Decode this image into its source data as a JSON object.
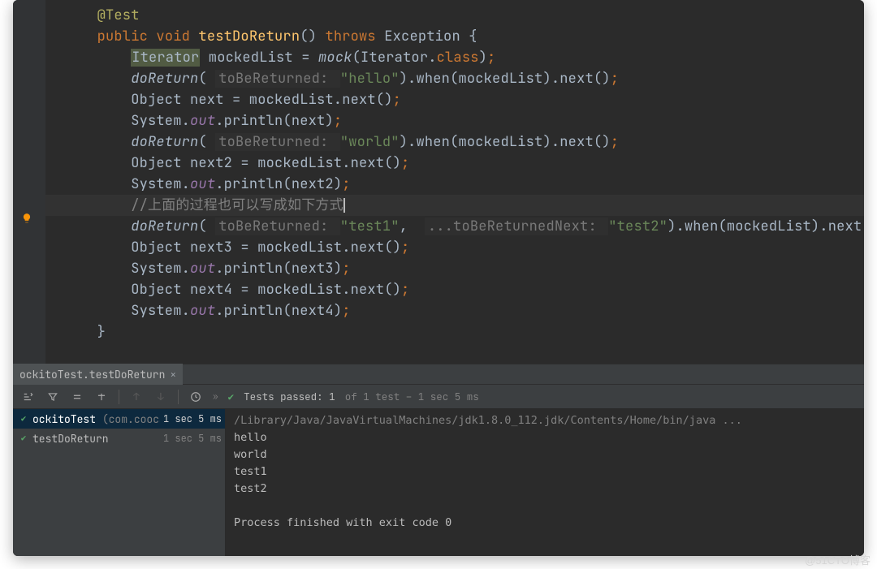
{
  "code": {
    "lines": [
      {
        "indent": 1,
        "segments": [
          {
            "t": "@Test",
            "c": "ann"
          }
        ]
      },
      {
        "indent": 1,
        "segments": [
          {
            "t": "public ",
            "c": "kw"
          },
          {
            "t": "void ",
            "c": "kw"
          },
          {
            "t": "testDoReturn",
            "c": "mname"
          },
          {
            "t": "() ",
            "c": "punct"
          },
          {
            "t": "throws ",
            "c": "kw"
          },
          {
            "t": "Exception ",
            "c": "type"
          },
          {
            "t": "{",
            "c": "punct"
          }
        ]
      },
      {
        "indent": 2,
        "segments": [
          {
            "t": "Iterator",
            "c": "type-hl"
          },
          {
            "t": " mockedList = ",
            "c": "punct"
          },
          {
            "t": "mock",
            "c": "call-it"
          },
          {
            "t": "(Iterator.",
            "c": "punct"
          },
          {
            "t": "class",
            "c": "kw"
          },
          {
            "t": ")",
            "c": "punct"
          },
          {
            "t": ";",
            "c": "sc"
          }
        ]
      },
      {
        "indent": 2,
        "segments": [
          {
            "t": "doReturn",
            "c": "call-it"
          },
          {
            "t": "( ",
            "c": "punct"
          },
          {
            "t": "toBeReturned: ",
            "c": "hint"
          },
          {
            "t": "\"hello\"",
            "c": "str"
          },
          {
            "t": ").",
            "c": "punct"
          },
          {
            "t": "when",
            "c": "punct"
          },
          {
            "t": "(mockedList).",
            "c": "punct"
          },
          {
            "t": "next",
            "c": "punct"
          },
          {
            "t": "()",
            "c": "punct"
          },
          {
            "t": ";",
            "c": "sc"
          }
        ]
      },
      {
        "indent": 2,
        "segments": [
          {
            "t": "Object next = mockedList.",
            "c": "punct"
          },
          {
            "t": "next",
            "c": "punct"
          },
          {
            "t": "()",
            "c": "punct"
          },
          {
            "t": ";",
            "c": "sc"
          }
        ]
      },
      {
        "indent": 2,
        "segments": [
          {
            "t": "System.",
            "c": "punct"
          },
          {
            "t": "out",
            "c": "field-it"
          },
          {
            "t": ".println(next)",
            "c": "punct"
          },
          {
            "t": ";",
            "c": "sc"
          }
        ]
      },
      {
        "indent": 2,
        "segments": [
          {
            "t": "doReturn",
            "c": "call-it"
          },
          {
            "t": "( ",
            "c": "punct"
          },
          {
            "t": "toBeReturned: ",
            "c": "hint"
          },
          {
            "t": "\"world\"",
            "c": "str"
          },
          {
            "t": ").",
            "c": "punct"
          },
          {
            "t": "when",
            "c": "punct"
          },
          {
            "t": "(mockedList).",
            "c": "punct"
          },
          {
            "t": "next",
            "c": "punct"
          },
          {
            "t": "()",
            "c": "punct"
          },
          {
            "t": ";",
            "c": "sc"
          }
        ]
      },
      {
        "indent": 2,
        "segments": [
          {
            "t": "Object next2 = mockedList.",
            "c": "punct"
          },
          {
            "t": "next",
            "c": "punct"
          },
          {
            "t": "()",
            "c": "punct"
          },
          {
            "t": ";",
            "c": "sc"
          }
        ]
      },
      {
        "indent": 2,
        "segments": [
          {
            "t": "System.",
            "c": "punct"
          },
          {
            "t": "out",
            "c": "field-it"
          },
          {
            "t": ".println(next2)",
            "c": "punct"
          },
          {
            "t": ";",
            "c": "sc"
          }
        ]
      },
      {
        "indent": 2,
        "hl": true,
        "segments": [
          {
            "t": "//上面的过程也可以写成如下方式",
            "c": "cmt"
          },
          {
            "caret": true
          }
        ]
      },
      {
        "indent": 2,
        "segments": [
          {
            "t": "doReturn",
            "c": "call-it"
          },
          {
            "t": "( ",
            "c": "punct"
          },
          {
            "t": "toBeReturned: ",
            "c": "hint"
          },
          {
            "t": "\"test1\"",
            "c": "str"
          },
          {
            "t": ",  ",
            "c": "punct"
          },
          {
            "t": "...toBeReturnedNext: ",
            "c": "hint"
          },
          {
            "t": "\"test2\"",
            "c": "str"
          },
          {
            "t": ").",
            "c": "punct"
          },
          {
            "t": "when",
            "c": "punct"
          },
          {
            "t": "(mockedList).",
            "c": "punct"
          },
          {
            "t": "next",
            "c": "punct"
          },
          {
            "t": "()",
            "c": "punct"
          },
          {
            "t": ";",
            "c": "sc"
          }
        ]
      },
      {
        "indent": 2,
        "segments": [
          {
            "t": "Object next3 = mockedList.",
            "c": "punct"
          },
          {
            "t": "next",
            "c": "punct"
          },
          {
            "t": "()",
            "c": "punct"
          },
          {
            "t": ";",
            "c": "sc"
          }
        ]
      },
      {
        "indent": 2,
        "segments": [
          {
            "t": "System.",
            "c": "punct"
          },
          {
            "t": "out",
            "c": "field-it"
          },
          {
            "t": ".println(next3)",
            "c": "punct"
          },
          {
            "t": ";",
            "c": "sc"
          }
        ]
      },
      {
        "indent": 2,
        "segments": [
          {
            "t": "Object next4 = mockedList.",
            "c": "punct"
          },
          {
            "t": "next",
            "c": "punct"
          },
          {
            "t": "()",
            "c": "punct"
          },
          {
            "t": ";",
            "c": "sc"
          }
        ]
      },
      {
        "indent": 2,
        "segments": [
          {
            "t": "System.",
            "c": "punct"
          },
          {
            "t": "out",
            "c": "field-it"
          },
          {
            "t": ".println(next4)",
            "c": "punct"
          },
          {
            "t": ";",
            "c": "sc"
          }
        ]
      },
      {
        "indent": 1,
        "segments": [
          {
            "t": "}",
            "c": "punct"
          }
        ]
      }
    ]
  },
  "tab": {
    "label": "ockitoTest.testDoReturn"
  },
  "tests_status": {
    "passed_label": "Tests passed:",
    "passed_count": "1",
    "of_text": "of 1 test",
    "duration": "– 1 sec 5 ms"
  },
  "tree": {
    "rows": [
      {
        "name": "ockitoTest",
        "pkg": " (com.coocaa.a",
        "time": "1 sec 5 ms",
        "selected": true
      },
      {
        "name": "testDoReturn",
        "pkg": "",
        "time": "1 sec 5 ms",
        "selected": false
      }
    ]
  },
  "console": {
    "path": "/Library/Java/JavaVirtualMachines/jdk1.8.0_112.jdk/Contents/Home/bin/java ...",
    "lines": [
      "hello",
      "world",
      "test1",
      "test2",
      "",
      "Process finished with exit code 0"
    ]
  },
  "watermark": "@51CTO博客"
}
